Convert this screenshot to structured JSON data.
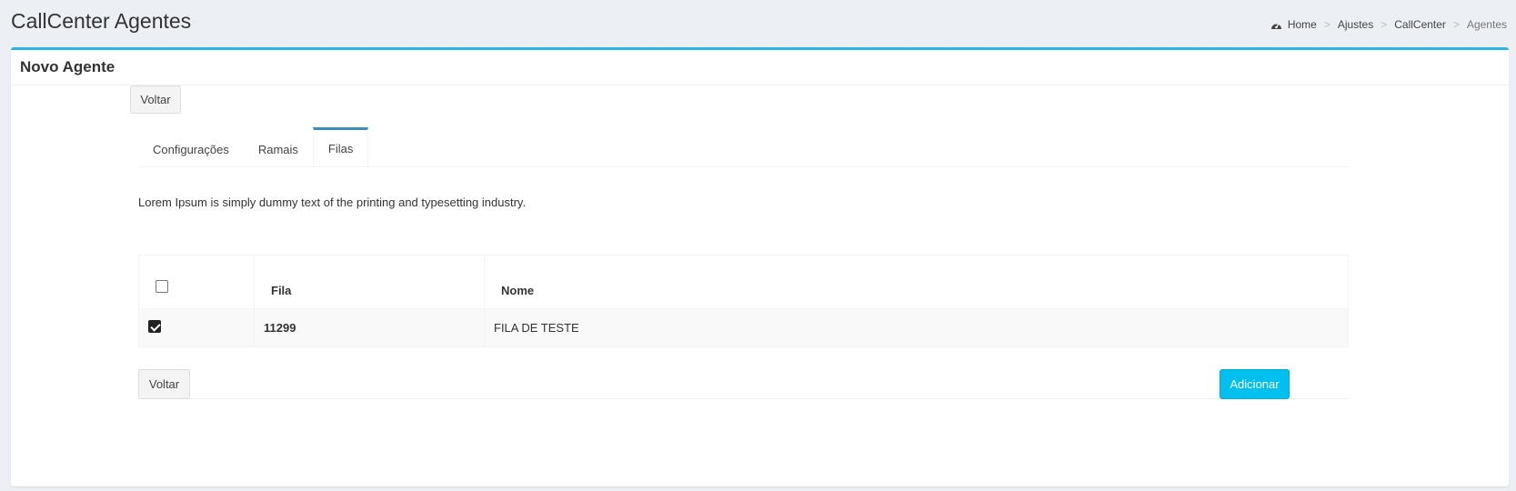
{
  "header": {
    "title": "CallCenter Agentes",
    "breadcrumb": [
      "Home",
      "Ajustes",
      "CallCenter",
      "Agentes"
    ]
  },
  "box": {
    "title": "Novo Agente"
  },
  "buttons": {
    "back_top": "Voltar",
    "back_bottom": "Voltar",
    "add": "Adicionar"
  },
  "tabs": [
    {
      "label": "Configurações",
      "active": false
    },
    {
      "label": "Ramais",
      "active": false
    },
    {
      "label": "Filas",
      "active": true
    }
  ],
  "description": "Lorem Ipsum is simply dummy text of the printing and typesetting industry.",
  "table": {
    "columns": [
      "",
      "Fila",
      "Nome"
    ],
    "header_checked": false,
    "rows": [
      {
        "checked": true,
        "fila": "11299",
        "nome": "FILA DE TESTE"
      }
    ]
  },
  "colors": {
    "accent": "#29b6e4",
    "primary_button": "#00c0ef",
    "active_tab": "#3c8dbc",
    "background": "#ecf0f5"
  },
  "icons": {
    "breadcrumb_home": "dashboard-icon"
  }
}
